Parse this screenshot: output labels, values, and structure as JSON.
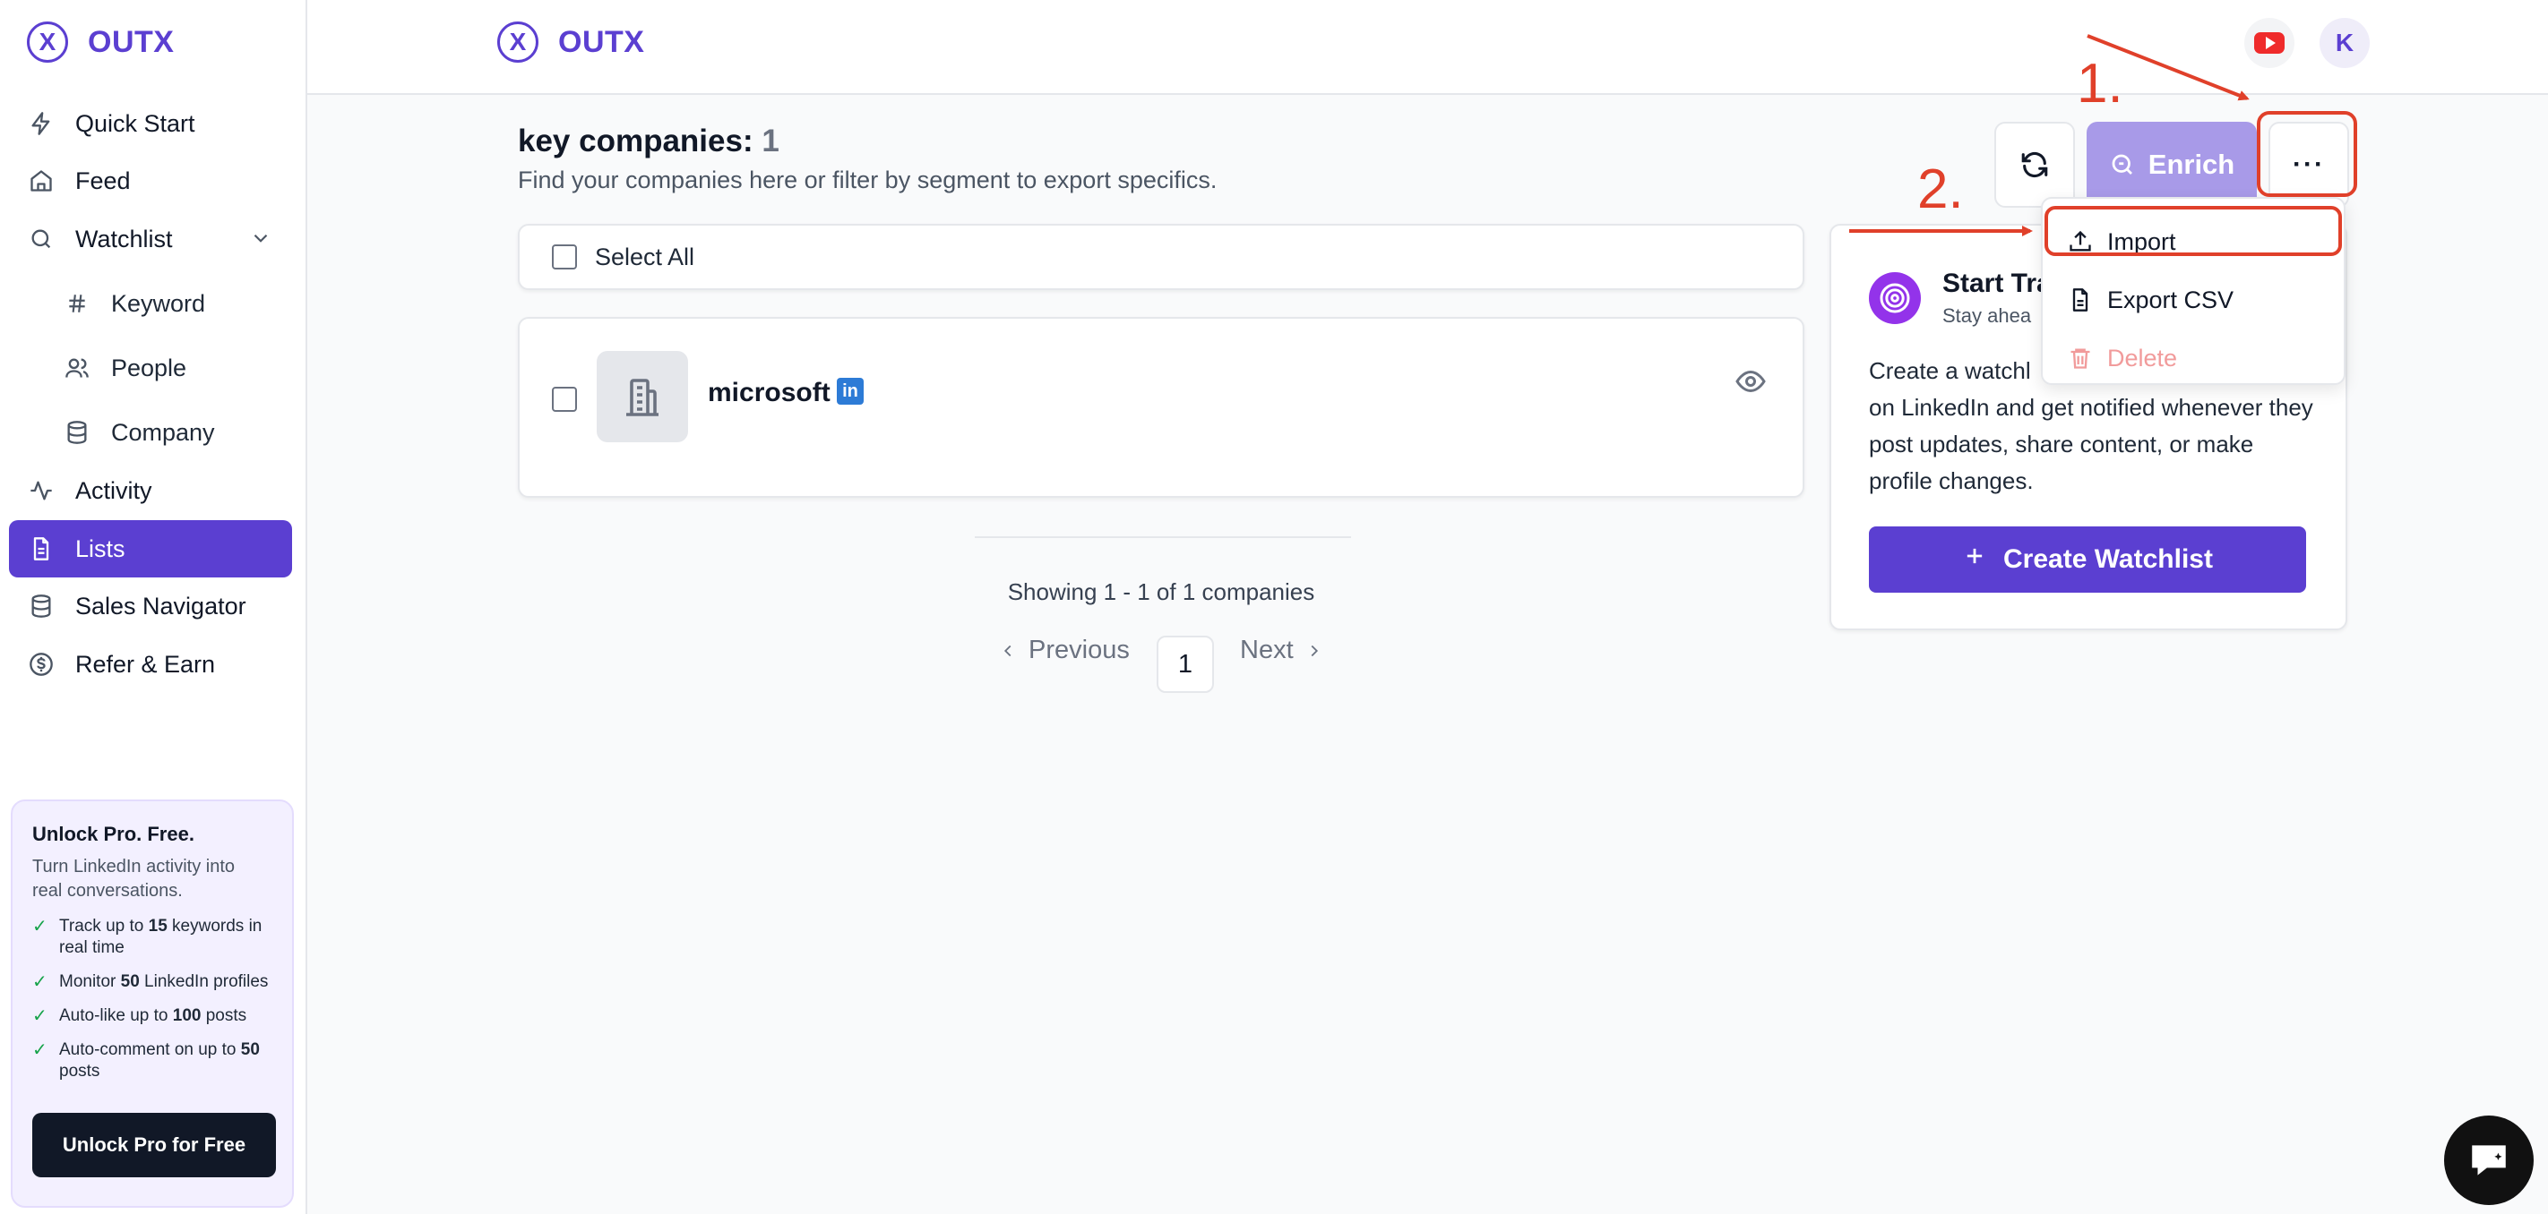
{
  "brand": {
    "name": "OUTX",
    "logo_glyph": "X"
  },
  "sidebar": {
    "items": [
      {
        "label": "Quick Start",
        "icon": "lightning-icon"
      },
      {
        "label": "Feed",
        "icon": "home-icon"
      },
      {
        "label": "Watchlist",
        "icon": "search-icon"
      },
      {
        "label": "Keyword",
        "icon": "hash-icon"
      },
      {
        "label": "People",
        "icon": "users-icon"
      },
      {
        "label": "Company",
        "icon": "database-icon"
      },
      {
        "label": "Activity",
        "icon": "activity-icon"
      },
      {
        "label": "Lists",
        "icon": "document-icon",
        "active": true
      },
      {
        "label": "Sales Navigator",
        "icon": "database-icon"
      },
      {
        "label": "Refer & Earn",
        "icon": "dollar-icon"
      }
    ],
    "promo": {
      "title": "Unlock Pro. Free.",
      "subtitle": "Turn LinkedIn activity into real conversations.",
      "features": [
        {
          "pre": "Track up to ",
          "bold": "15",
          "post": " keywords in real time"
        },
        {
          "pre": "Monitor ",
          "bold": "50",
          "post": " LinkedIn profiles"
        },
        {
          "pre": "Auto-like up to ",
          "bold": "100",
          "post": " posts"
        },
        {
          "pre": "Auto-comment on up to ",
          "bold": "50",
          "post": " posts"
        }
      ],
      "button": "Unlock Pro for Free"
    }
  },
  "header": {
    "avatar_letter": "K",
    "youtube_icon": "youtube-icon"
  },
  "page": {
    "title": "key companies:",
    "count": "1",
    "subtitle": "Find your companies here or filter by segment to export specifics.",
    "select_all": "Select All",
    "company": {
      "name": "microsoft",
      "linkedin_badge": "in"
    },
    "showing": "Showing 1 - 1 of 1 companies",
    "pagination": {
      "previous": "Previous",
      "current": "1",
      "next": "Next"
    }
  },
  "toolbar": {
    "enrich": "Enrich",
    "more": "···"
  },
  "menu": {
    "import": "Import",
    "export": "Export CSV",
    "delete": "Delete"
  },
  "watchlist_card": {
    "title": "Start Tra",
    "subtitle": "Stay ahea",
    "description_line1": "Create a watchl",
    "description_rest": "on LinkedIn and get notified whenever they post updates, share content, or make profile changes.",
    "button": "Create Watchlist"
  },
  "annotations": {
    "step1": "1.",
    "step2": "2.",
    "color": "#e0402a"
  },
  "colors": {
    "accent": "#5b3fd1",
    "enrich_disabled": "#a89ae8",
    "delete": "#f19b9b"
  }
}
